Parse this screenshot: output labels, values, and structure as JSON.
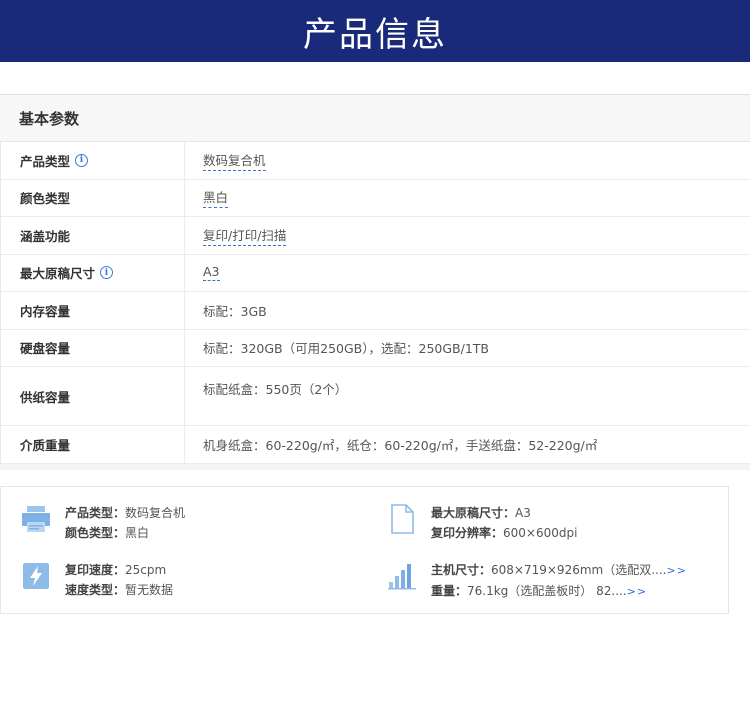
{
  "banner": {
    "title": "产品信息"
  },
  "params": {
    "header": "基本参数",
    "rows": [
      {
        "label": "产品类型",
        "value": "数码复合机"
      },
      {
        "label": "颜色类型",
        "value": "黑白"
      },
      {
        "label": "涵盖功能",
        "value": "复印/打印/扫描"
      },
      {
        "label": "最大原稿尺寸",
        "value": "A3"
      },
      {
        "label": "内存容量",
        "value": "标配：3GB"
      },
      {
        "label": "硬盘容量",
        "value": "标配：320GB（可用250GB），选配：250GB/1TB"
      },
      {
        "label": "供纸容量",
        "value": "标配纸盒：550页（2个）"
      },
      {
        "label": "介质重量",
        "value": "机身纸盒：60-220g/㎡，纸仓：60-220g/㎡，手送纸盘：52-220g/㎡"
      }
    ]
  },
  "summary": {
    "items": [
      {
        "icon": "printer-icon",
        "lines": [
          {
            "key": "产品类型：",
            "value": "数码复合机"
          },
          {
            "key": "颜色类型：",
            "value": "黑白"
          }
        ]
      },
      {
        "icon": "document-icon",
        "lines": [
          {
            "key": "最大原稿尺寸：",
            "value": "A3"
          },
          {
            "key": "复印分辨率：",
            "value": "600×600dpi"
          }
        ]
      },
      {
        "icon": "lightning-icon",
        "lines": [
          {
            "key": "复印速度：",
            "value": "25cpm"
          },
          {
            "key": "速度类型：",
            "value": "暂无数据"
          }
        ]
      },
      {
        "icon": "size-chart-icon",
        "lines": [
          {
            "key": "主机尺寸：",
            "value": "608×719×926mm（选配双....",
            "more": ">>"
          },
          {
            "key": "重量：",
            "value": "76.1kg（选配盖板时） 82....",
            "more": ">>"
          }
        ]
      }
    ]
  },
  "colors": {
    "banner": "#1a2a7a",
    "accent": "#3a7bd5",
    "icon": "#8fbbe8"
  }
}
